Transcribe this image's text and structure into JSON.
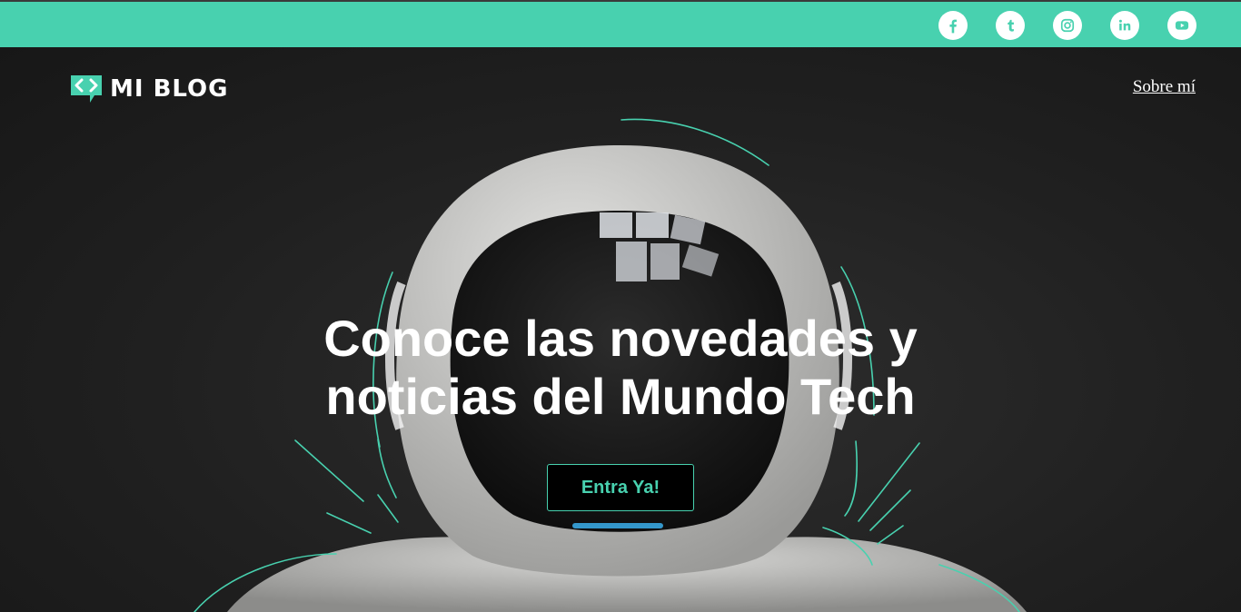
{
  "colors": {
    "accent": "#48d1af",
    "background": "#1e1e1e",
    "text": "#ffffff"
  },
  "topbar": {
    "socials": [
      {
        "icon": "facebook-icon"
      },
      {
        "icon": "tumblr-icon"
      },
      {
        "icon": "instagram-icon"
      },
      {
        "icon": "linkedin-icon"
      },
      {
        "icon": "youtube-icon"
      }
    ]
  },
  "header": {
    "logo_text": "MI BLOG",
    "nav": {
      "about_label": "Sobre mí"
    }
  },
  "hero": {
    "headline_line1": "Conoce las novedades y",
    "headline_line2": "noticias del Mundo Tech",
    "cta_label": "Entra Ya!"
  }
}
